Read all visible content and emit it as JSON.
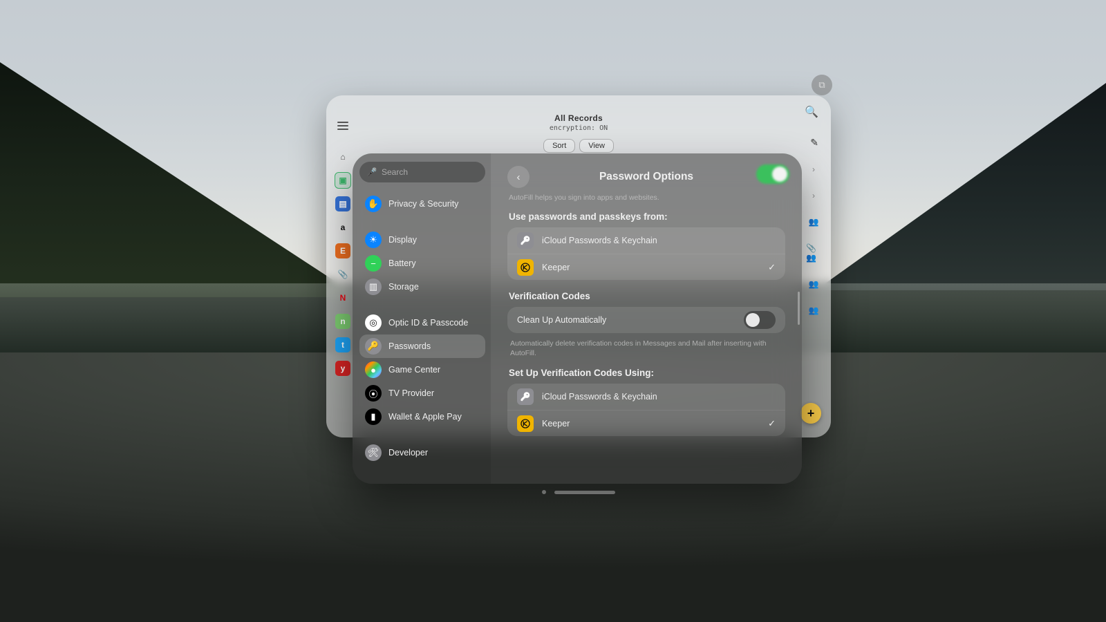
{
  "background_app": {
    "title": "All Records",
    "subtitle": "encryption: ON",
    "segmented": {
      "sort": "Sort",
      "view": "View"
    },
    "mini_sidebar": [
      {
        "name": "home-icon",
        "glyph": "⌂",
        "bg": "transparent",
        "fg": "#555"
      },
      {
        "name": "folder-icon",
        "glyph": "▣",
        "bg": "#3cb46a",
        "fg": "#fff",
        "boxed": true
      },
      {
        "name": "files-icon",
        "glyph": "▤",
        "bg": "#3572d6",
        "fg": "#fff"
      },
      {
        "name": "amazon-icon",
        "glyph": "a",
        "bg": "transparent",
        "fg": "#111"
      },
      {
        "name": "etsy-icon",
        "glyph": "E",
        "bg": "#eb6d20",
        "fg": "#fff"
      },
      {
        "name": "attach-icon",
        "glyph": "📎",
        "bg": "transparent",
        "fg": "#777"
      },
      {
        "name": "netflix-icon",
        "glyph": "N",
        "bg": "#e50914",
        "fg": "#e50914",
        "plain": true
      },
      {
        "name": "green-icon",
        "glyph": "n",
        "bg": "#7bc96f",
        "fg": "#fff"
      },
      {
        "name": "twitter-icon",
        "glyph": "t",
        "bg": "#1da1f2",
        "fg": "#fff"
      },
      {
        "name": "yelp-icon",
        "glyph": "y",
        "bg": "#d32323",
        "fg": "#fff"
      }
    ],
    "right_glyphs": [
      "›",
      "›",
      "👥",
      "📎 👥",
      "👥",
      "👥"
    ],
    "add_glyph": "+"
  },
  "settings": {
    "search_placeholder": "Search",
    "sidebar": [
      {
        "name": "privacy-security",
        "label": "Privacy & Security",
        "icon_bg": "#0a84ff",
        "glyph": "✋"
      },
      {
        "break": true
      },
      {
        "name": "display",
        "label": "Display",
        "icon_bg": "#0a84ff",
        "glyph": "☀"
      },
      {
        "name": "battery",
        "label": "Battery",
        "icon_bg": "#30d158",
        "glyph": "−"
      },
      {
        "name": "storage",
        "label": "Storage",
        "icon_bg": "#8e8e93",
        "glyph": "▥"
      },
      {
        "break": true
      },
      {
        "name": "optic-id",
        "label": "Optic ID & Passcode",
        "icon_bg": "#ffffff",
        "glyph": "◎",
        "glyph_fg": "#111"
      },
      {
        "name": "passwords",
        "label": "Passwords",
        "icon_bg": "#8e8e93",
        "glyph": "🔑",
        "selected": true
      },
      {
        "name": "game-center",
        "label": "Game Center",
        "icon_bg": "linear-gradient(135deg,#ff2d55,#ff9500,#34c759,#5ac8fa,#af52de)",
        "glyph": "●"
      },
      {
        "name": "tv-provider",
        "label": "TV Provider",
        "icon_bg": "#000000",
        "glyph": "⦿"
      },
      {
        "name": "wallet",
        "label": "Wallet & Apple Pay",
        "icon_bg": "#000000",
        "glyph": "▮"
      },
      {
        "break": true
      },
      {
        "name": "developer",
        "label": "Developer",
        "icon_bg": "#8e8e93",
        "glyph": "🛠"
      }
    ],
    "detail": {
      "title": "Password Options",
      "help": "AutoFill helps you sign into apps and websites.",
      "use_from_label": "Use passwords and passkeys from:",
      "providers": [
        {
          "name": "icloud-keychain",
          "label": "iCloud Passwords & Keychain",
          "kind": "key",
          "checked": false
        },
        {
          "name": "keeper",
          "label": "Keeper",
          "kind": "keeper",
          "checked": true
        }
      ],
      "verif_label": "Verification Codes",
      "cleanup_label": "Clean Up Automatically",
      "cleanup_on": false,
      "cleanup_caption": "Automatically delete verification codes in Messages and Mail after inserting with AutoFill.",
      "setup_label": "Set Up Verification Codes Using:",
      "setup_providers": [
        {
          "name": "icloud-keychain",
          "label": "iCloud Passwords & Keychain",
          "kind": "key",
          "checked": false
        },
        {
          "name": "keeper",
          "label": "Keeper",
          "kind": "keeper",
          "checked": true
        }
      ]
    }
  }
}
